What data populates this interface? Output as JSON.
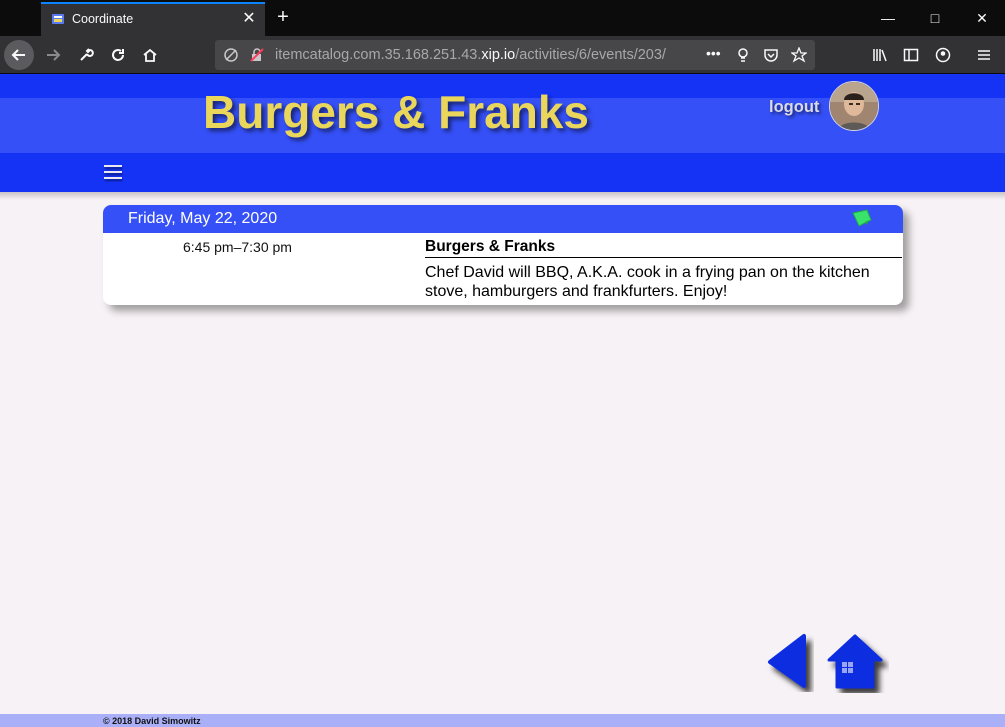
{
  "browser": {
    "tab_title": "Coordinate",
    "url_prefix": "itemcatalog.com.35.168.251.43.",
    "url_host": "xip.io",
    "url_path": "/activities/6/events/203/"
  },
  "header": {
    "title": "Burgers & Franks",
    "logout_label": "logout"
  },
  "event": {
    "date": "Friday, May 22, 2020",
    "time": "6:45 pm–7:30 pm",
    "title": "Burgers & Franks",
    "description": "Chef David will BBQ, A.K.A. cook in a frying pan on the kitchen stove, hamburgers and frankfurters. Enjoy!"
  },
  "footer": {
    "copyright": "© 2018 David Simowitz"
  },
  "colors": {
    "header_blue": "#1433f5",
    "band_blue": "#3550f7",
    "title_yellow": "#e9d65a",
    "nav_icon_blue": "#0f2de0",
    "page_background": "#f7f2f5"
  },
  "icons": {
    "menu": "hamburger-menu-icon",
    "note": "sticky-note-icon",
    "back": "back-arrow-icon",
    "home": "home-icon"
  }
}
